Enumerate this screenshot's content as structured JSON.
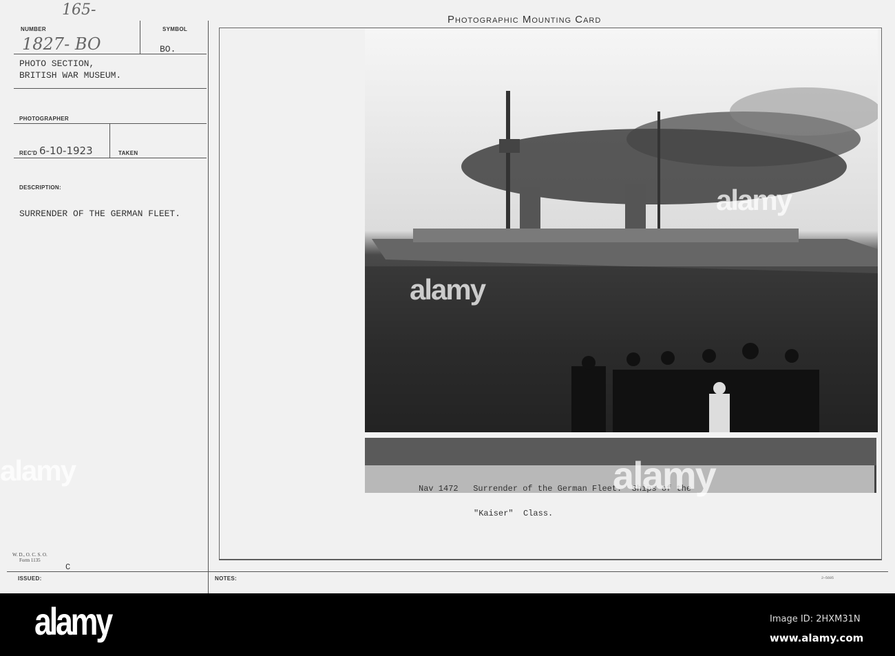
{
  "card": {
    "title": "Photographic Mounting Card",
    "page_mark": "165-",
    "number_label": "NUMBER",
    "number_value": "1827- BO",
    "symbol_label": "SYMBOL",
    "symbol_value": "BO.",
    "source_line1": "PHOTO SECTION,",
    "source_line2": "BRITISH WAR MUSEUM.",
    "photographer_label": "PHOTOGRAPHER",
    "recd_label": "REC'D",
    "recd_value": "6-10-1923",
    "taken_label": "TAKEN",
    "description_label": "DESCRIPTION:",
    "description_value": "SURRENDER OF THE GERMAN FLEET.",
    "form_line1": "W. D., O. C. S. O.",
    "form_line2": "Form 1135",
    "issued_mark": "C",
    "issued_label": "ISSUED:",
    "notes_label": "NOTES:",
    "print_code": "2—5605"
  },
  "photo": {
    "caption_line1": "Nav 1472   Surrender of the German Fleet.  Ships of the",
    "caption_line2": "\"Kaiser\"  Class."
  },
  "watermark": {
    "text": "alamy"
  },
  "footer": {
    "logo": "alamy",
    "image_id": "Image ID: 2HXM31N",
    "url": "www.alamy.com"
  }
}
